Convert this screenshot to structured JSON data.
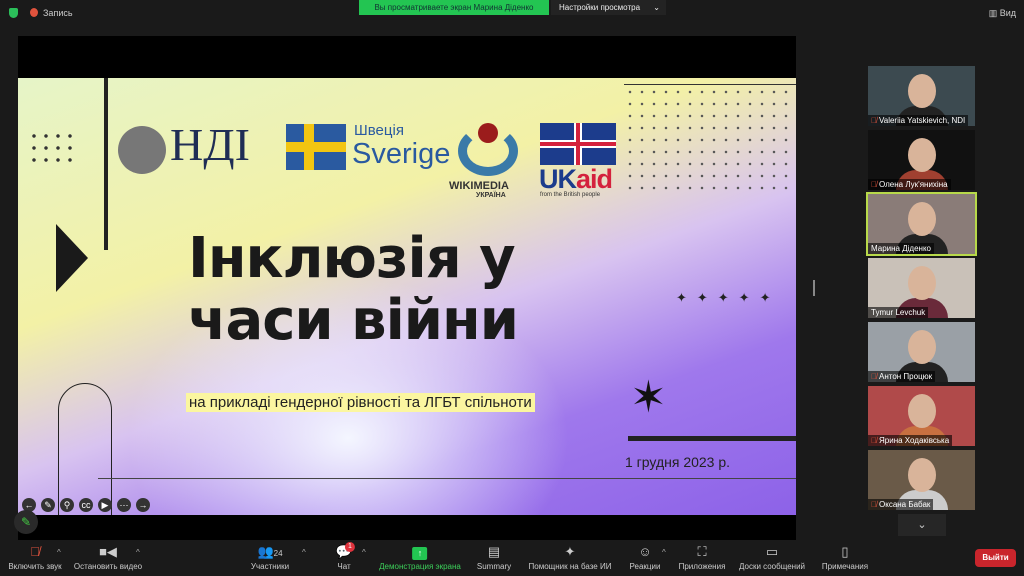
{
  "topbar": {
    "recording_label": "Запись",
    "banner": "Вы просматриваете экран Марина Діденко",
    "view_settings": "Настройки просмотра",
    "view_label": "Вид"
  },
  "slide": {
    "logos": {
      "ndi": "НДІ",
      "sweden_small": "Швеція",
      "sweden_big": "Sverige",
      "wikimedia": "WIKIMEDIA",
      "wikimedia_sub": "УКРАЇНА",
      "ukaid_uk": "UK",
      "ukaid_aid": "aid",
      "ukaid_sub": "from the British people"
    },
    "title_line1": "Інклюзія у",
    "title_line2": "часи війни",
    "subtitle": "на прикладі гендерної рівності та ЛГБТ спільноти",
    "date": "1 грудня 2023 р.",
    "stars": "✦✦✦✦✦"
  },
  "participants": [
    {
      "name": "Valeriia Yatskievich, NDI",
      "muted": true,
      "bg": "#3c4a50",
      "shirt": "#222"
    },
    {
      "name": "Олена Лук'янихіна",
      "muted": true,
      "bg": "#111",
      "shirt": "#a04030"
    },
    {
      "name": "Марина Діденко",
      "muted": false,
      "bg": "#8a7c78",
      "shirt": "#222"
    },
    {
      "name": "Tymur Levchuk",
      "muted": false,
      "bg": "#c9c1b8",
      "shirt": "#6a2a3a"
    },
    {
      "name": "Антон Процюк",
      "muted": true,
      "bg": "#9aa0a6",
      "shirt": "#222"
    },
    {
      "name": "Ярина Ходаківська",
      "muted": true,
      "bg": "#b04a4a",
      "shirt": "#c87040"
    },
    {
      "name": "Оксана Бабак",
      "muted": true,
      "bg": "#6a5a48",
      "shirt": "#ccc"
    }
  ],
  "toolbar": {
    "unmute": "Включить звук",
    "stop_video": "Остановить видео",
    "participants": "Участники",
    "participants_count": "24",
    "chat": "Чат",
    "chat_badge": "1",
    "share": "Демонстрация экрана",
    "summary": "Summary",
    "ai": "Помощник на базе ИИ",
    "reactions": "Реакции",
    "apps": "Приложения",
    "whiteboards": "Доски сообщений",
    "notes": "Примечания",
    "leave": "Выйти"
  }
}
